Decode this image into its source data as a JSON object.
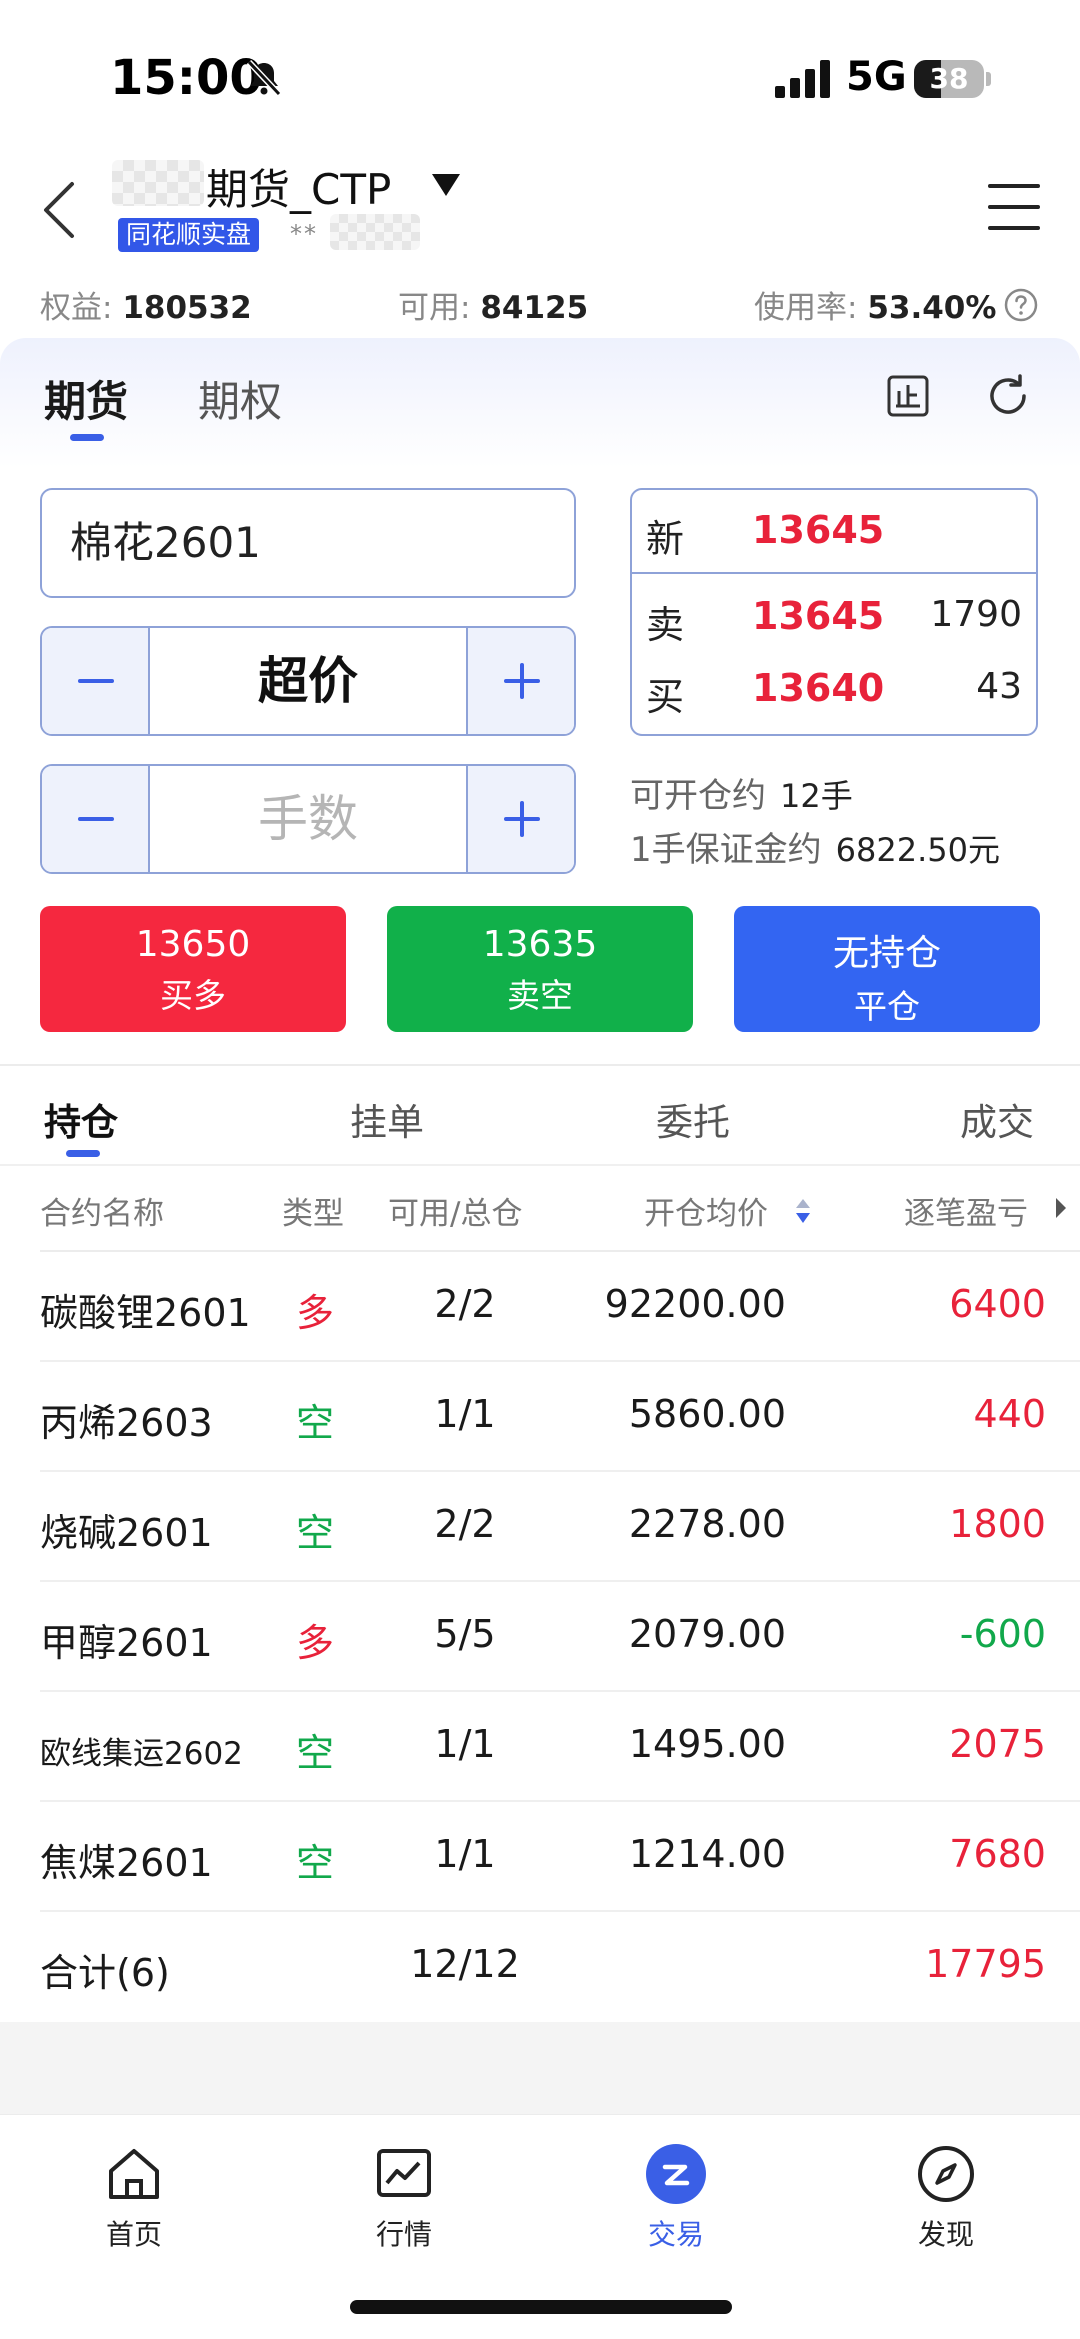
{
  "status_bar": {
    "time": "15:00",
    "network": "5G",
    "battery": "38",
    "battery_level": 0.38
  },
  "header": {
    "account_title": "期货_CTP",
    "badge": "同花顺实盘",
    "masked_id": "**"
  },
  "summary": [
    {
      "label": "权益: ",
      "value": "180532"
    },
    {
      "label": "可用: ",
      "value": "84125"
    },
    {
      "label": "使用率: ",
      "value": "53.40%"
    }
  ],
  "product_tabs": [
    "期货",
    "期权"
  ],
  "order_form": {
    "contract": "棉花2601",
    "price_mode": "超价",
    "quantity_placeholder": "手数",
    "quote": {
      "last_label": "新",
      "last_price": "13645",
      "ask_label": "卖",
      "ask_price": "13645",
      "ask_vol": "1790",
      "bid_label": "买",
      "bid_price": "13640",
      "bid_vol": "43"
    },
    "can_open_label": "可开仓约",
    "can_open_value": "12手",
    "margin_label": "1手保证金约",
    "margin_value": "6822.50元"
  },
  "trade_buttons": {
    "buy": {
      "price": "13650",
      "label": "买多"
    },
    "sell": {
      "price": "13635",
      "label": "卖空"
    },
    "close": {
      "price": "无持仓",
      "label": "平仓"
    }
  },
  "position_tabs": [
    "持仓",
    "挂单",
    "委托",
    "成交"
  ],
  "table": {
    "headers": [
      "合约名称",
      "类型",
      "可用/总仓",
      "开仓均价",
      "逐笔盈亏"
    ],
    "rows": [
      {
        "name": "碳酸锂2601",
        "type": "多",
        "qty": "2/2",
        "avg_price": "92200.00",
        "pnl": "6400"
      },
      {
        "name": "丙烯2603",
        "type": "空",
        "qty": "1/1",
        "avg_price": "5860.00",
        "pnl": "440"
      },
      {
        "name": "烧碱2601",
        "type": "空",
        "qty": "2/2",
        "avg_price": "2278.00",
        "pnl": "1800"
      },
      {
        "name": "甲醇2601",
        "type": "多",
        "qty": "5/5",
        "avg_price": "2079.00",
        "pnl": "-600"
      },
      {
        "name": "欧线集运2602",
        "type": "空",
        "qty": "1/1",
        "avg_price": "1495.00",
        "pnl": "2075"
      },
      {
        "name": "焦煤2601",
        "type": "空",
        "qty": "1/1",
        "avg_price": "1214.00",
        "pnl": "7680"
      }
    ],
    "total": {
      "label": "合计(6)",
      "qty": "12/12",
      "pnl": "17795"
    }
  },
  "bottom_nav": [
    "首页",
    "行情",
    "交易",
    "发现"
  ],
  "colors": {
    "accent": "#3a5fe6",
    "up": "#e8223a",
    "down": "#11a84b",
    "buy": "#f5283f",
    "sell": "#11b04a",
    "close": "#3365f2"
  }
}
